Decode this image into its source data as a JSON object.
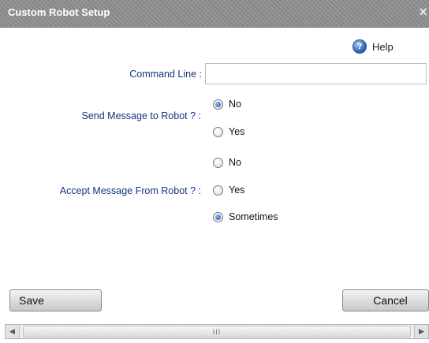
{
  "window": {
    "title": "Custom Robot Setup",
    "close_glyph": "×"
  },
  "help": {
    "label": "Help",
    "icon": "help-icon",
    "glyph": "?"
  },
  "form": {
    "command_line": {
      "label": "Command Line :",
      "value": ""
    },
    "send_message": {
      "label": "Send Message to Robot ? :",
      "options": [
        {
          "label": "No",
          "checked": true
        },
        {
          "label": "Yes",
          "checked": false
        }
      ]
    },
    "accept_message": {
      "label": "Accept Message From Robot ? :",
      "options": [
        {
          "label": "No",
          "checked": false
        },
        {
          "label": "Yes",
          "checked": false
        },
        {
          "label": "Sometimes",
          "checked": true
        }
      ]
    }
  },
  "buttons": {
    "save": "Save",
    "cancel": "Cancel"
  },
  "scrollbar": {
    "left_arrow": "◀",
    "right_arrow": "▶",
    "grip": "III"
  },
  "colors": {
    "title_bar": "#8d8d8d",
    "label_text": "#13357e",
    "radio_accent": "#1d58b5"
  }
}
